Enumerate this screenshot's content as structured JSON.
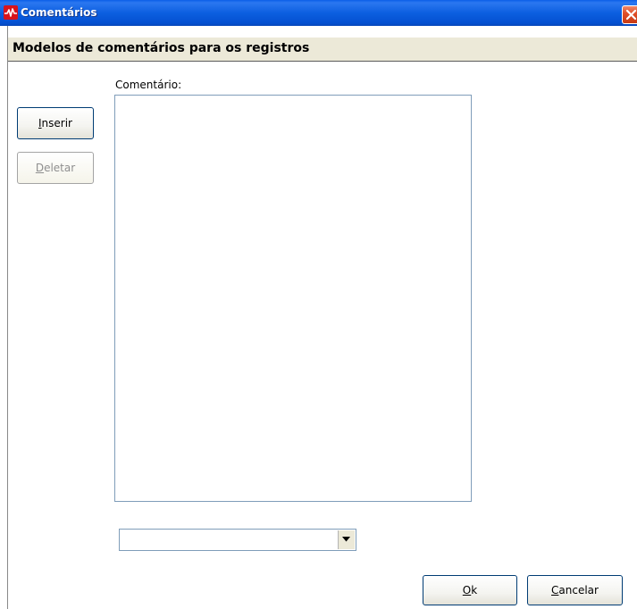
{
  "window": {
    "title": "Comentários"
  },
  "header": {
    "title": "Modelos de comentários para os registros"
  },
  "form": {
    "comment_label": "Comentário:",
    "comment_value": "",
    "template_select_value": ""
  },
  "buttons": {
    "inserir_prefix": "I",
    "inserir_rest": "nserir",
    "deletar_prefix": "D",
    "deletar_rest": "eletar",
    "ok_prefix": "O",
    "ok_rest": "k",
    "cancelar_prefix": "C",
    "cancelar_rest": "ancelar"
  },
  "icons": {
    "app": "heartbeat-icon",
    "close": "close-icon",
    "dropdown": "chevron-down-icon"
  },
  "colors": {
    "titlebar": "#0c5fe0",
    "close_button": "#e0502a",
    "app_icon": "#d8141b",
    "banner": "#ece9d8"
  }
}
